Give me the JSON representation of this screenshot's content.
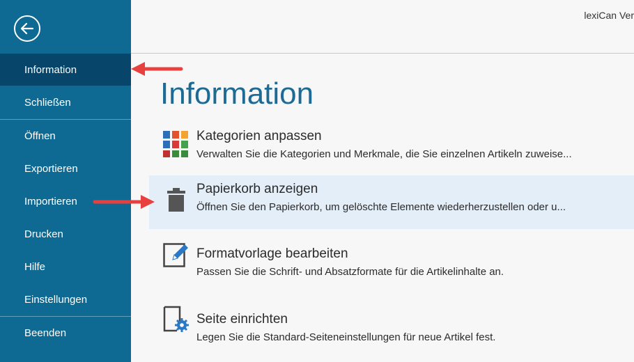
{
  "app": {
    "title": "lexiCan Ver"
  },
  "sidebar": {
    "items": [
      {
        "label": "Information",
        "active": true
      },
      {
        "label": "Schließen"
      },
      {
        "label": "Öffnen"
      },
      {
        "label": "Exportieren"
      },
      {
        "label": "Importieren"
      },
      {
        "label": "Drucken"
      },
      {
        "label": "Hilfe"
      },
      {
        "label": "Einstellungen"
      },
      {
        "label": "Beenden"
      }
    ]
  },
  "main": {
    "title": "Information",
    "options": [
      {
        "title": "Kategorien anpassen",
        "desc": "Verwalten Sie die Kategorien und Merkmale, die Sie einzelnen Artikeln zuweise...",
        "icon": "categories-grid-icon"
      },
      {
        "title": "Papierkorb anzeigen",
        "desc": "Öffnen Sie den Papierkorb, um gelöschte Elemente wiederherzustellen oder u...",
        "icon": "trash-icon",
        "highlighted": true
      },
      {
        "title": "Formatvorlage bearbeiten",
        "desc": "Passen Sie die Schrift- und Absatzformate für die Artikelinhalte an.",
        "icon": "edit-document-icon"
      },
      {
        "title": "Seite einrichten",
        "desc": "Legen Sie die Standard-Seiteneinstellungen für neue Artikel fest.",
        "icon": "page-settings-icon"
      }
    ]
  },
  "colors": {
    "sidebar_bg": "#0e6a93",
    "sidebar_active": "#08456b",
    "title_blue": "#1d6a94",
    "highlight_bg": "#e4eef8",
    "annotation_arrow": "#e8403e"
  }
}
